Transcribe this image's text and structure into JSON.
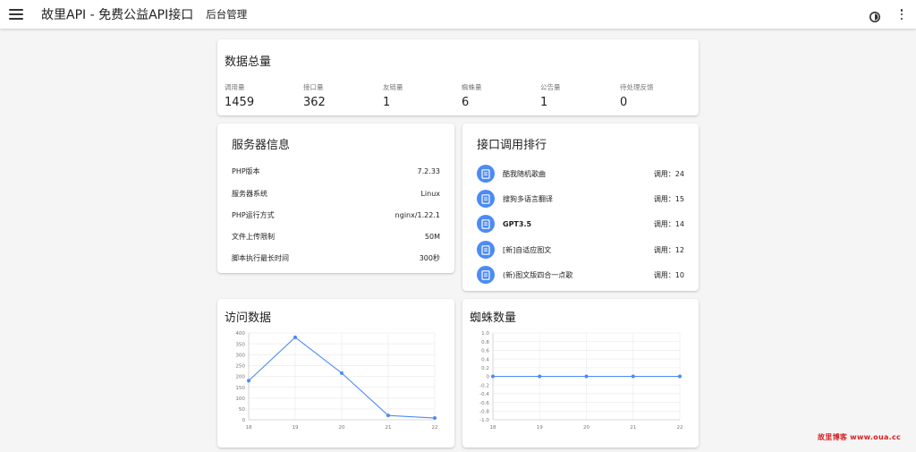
{
  "appbar": {
    "title": "故里API - 免费公益API接口",
    "subtitle": "后台管理"
  },
  "totals": {
    "title": "数据总量",
    "stats": [
      {
        "label": "调用量",
        "value": "1459"
      },
      {
        "label": "接口量",
        "value": "362"
      },
      {
        "label": "友链量",
        "value": "1"
      },
      {
        "label": "蜘蛛量",
        "value": "6"
      },
      {
        "label": "公告量",
        "value": "1"
      },
      {
        "label": "待处理反馈",
        "value": "0"
      }
    ]
  },
  "server": {
    "title": "服务器信息",
    "rows": [
      {
        "key": "PHP版本",
        "value": "7.2.33"
      },
      {
        "key": "服务器系统",
        "value": "Linux"
      },
      {
        "key": "PHP运行方式",
        "value": "nginx/1.22.1"
      },
      {
        "key": "文件上传限制",
        "value": "50M"
      },
      {
        "key": "脚本执行最长时间",
        "value": "300秒"
      }
    ]
  },
  "ranking": {
    "title": "接口调用排行",
    "items": [
      {
        "name": "酷我随机歌曲",
        "count": "调用：24"
      },
      {
        "name": "搜狗多语言翻译",
        "count": "调用：15"
      },
      {
        "name": "GPT3.5",
        "count": "调用：14"
      },
      {
        "name": "[新]自适应图文",
        "count": "调用：12"
      },
      {
        "name": "(新)图文版四合一点歌",
        "count": "调用：10"
      }
    ]
  },
  "visits": {
    "title": "访问数据"
  },
  "spiders": {
    "title": "蜘蛛数量"
  },
  "watermark": "故里博客 www.oua.cc",
  "chart_data": [
    {
      "type": "line",
      "title": "访问数据",
      "x": [
        "18",
        "19",
        "20",
        "21",
        "22"
      ],
      "series": [
        {
          "values": [
            180,
            380,
            215,
            20,
            8
          ]
        }
      ],
      "ylim": [
        0,
        400
      ],
      "yticks": [
        "0",
        "50",
        "100",
        "150",
        "200",
        "250",
        "300",
        "350",
        "400"
      ],
      "grid": true,
      "color": "#4c8bf5"
    },
    {
      "type": "line",
      "title": "蜘蛛数量",
      "x": [
        "18",
        "19",
        "20",
        "21",
        "22"
      ],
      "series": [
        {
          "values": [
            0,
            0,
            0,
            0,
            0
          ]
        }
      ],
      "ylim": [
        -1.0,
        1.0
      ],
      "yticks": [
        "-1.0",
        "-0.8",
        "-0.6",
        "-0.4",
        "-0.2",
        "0",
        "0.2",
        "0.4",
        "0.6",
        "0.8",
        "1.0"
      ],
      "grid": true,
      "color": "#4c8bf5"
    }
  ]
}
